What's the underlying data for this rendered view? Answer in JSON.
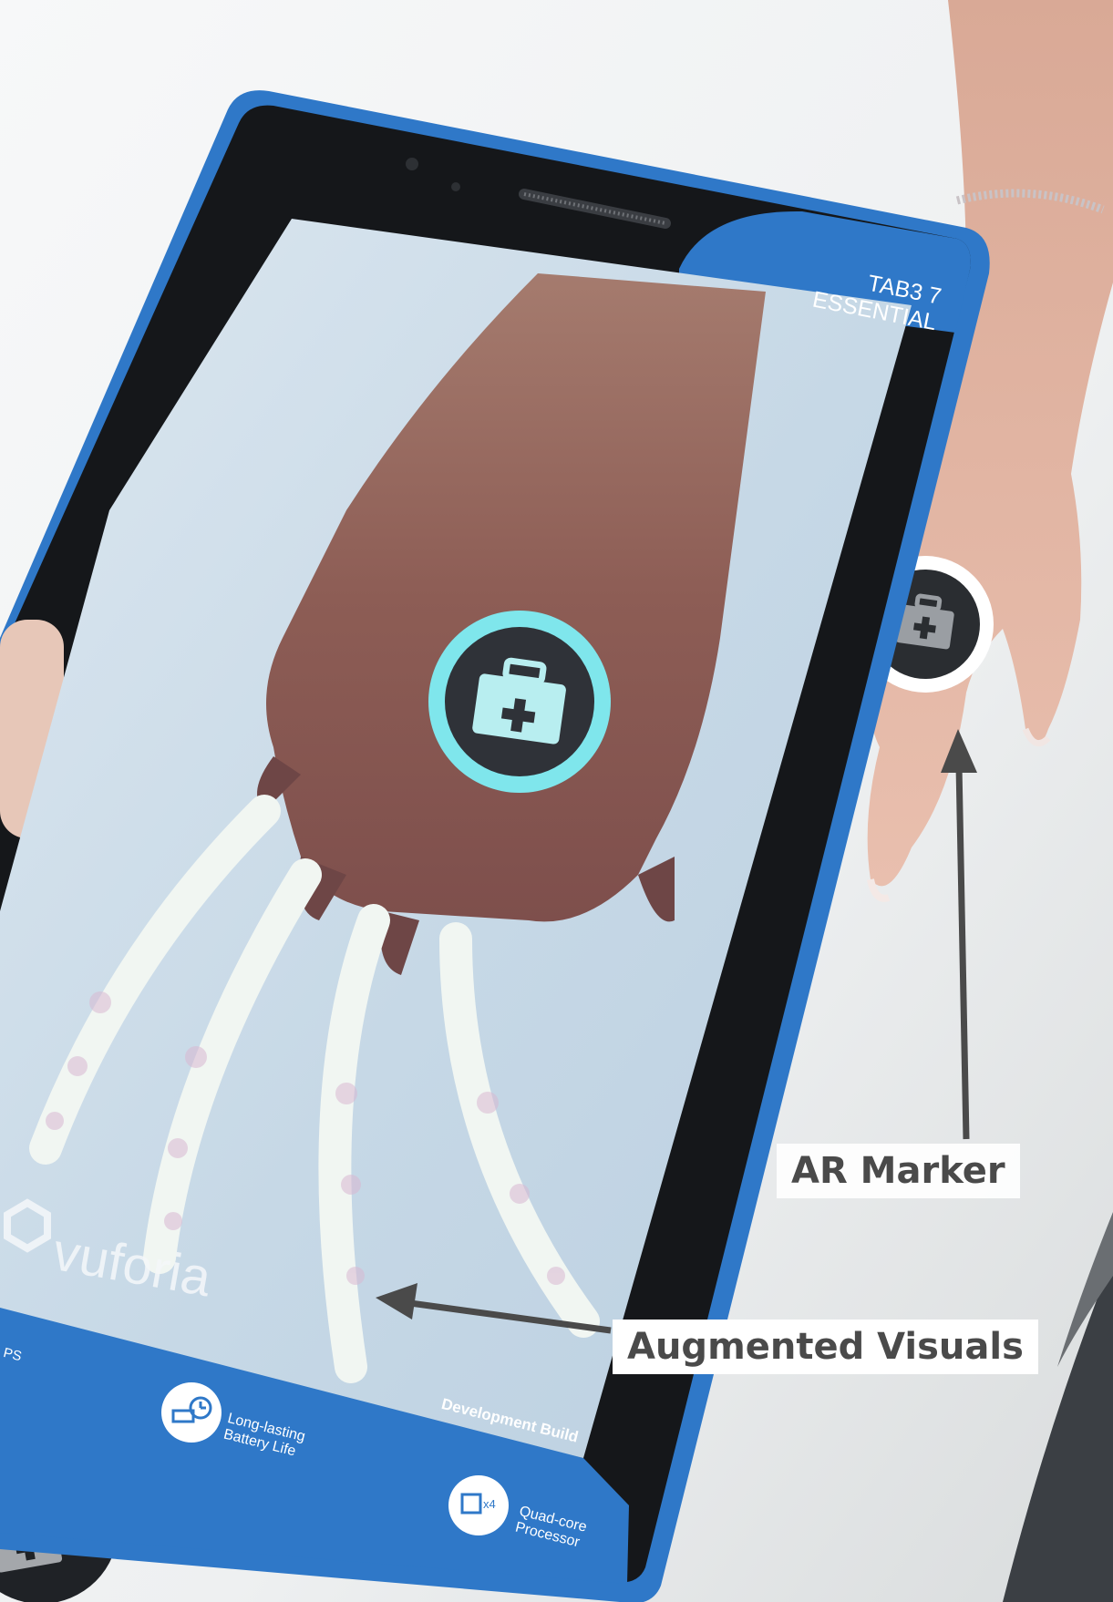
{
  "tablet": {
    "model_line1": "TAB3 7",
    "model_line2": "ESSENTIAL",
    "features": [
      {
        "icon": "battery-clock-icon",
        "line1": "Long-lasting",
        "line2": "Battery Life"
      },
      {
        "icon": "cpu-icon",
        "line1": "Quad-core",
        "line2": "Processor",
        "badge": "x4"
      }
    ],
    "edge_text": "PS",
    "body_color": "#2f78c8",
    "accent_color": "#4aa3df"
  },
  "screen": {
    "watermark": "vuforia",
    "build_label": "Development Build",
    "marker_ring_color": "#7fe6ec"
  },
  "annotations": {
    "ar_marker": "AR Marker",
    "augmented_visuals": "Augmented Visuals"
  }
}
